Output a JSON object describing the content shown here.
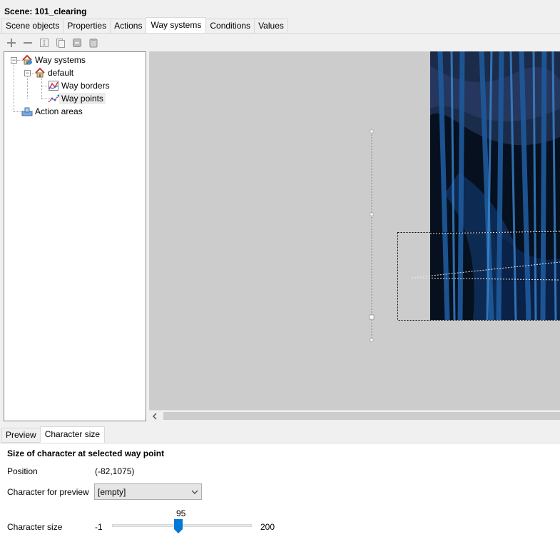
{
  "title": "Scene: 101_clearing",
  "tabs": [
    {
      "label": "Scene objects"
    },
    {
      "label": "Properties"
    },
    {
      "label": "Actions"
    },
    {
      "label": "Way systems",
      "active": true
    },
    {
      "label": "Conditions"
    },
    {
      "label": "Values"
    }
  ],
  "toolbar": {
    "icons": [
      "add-icon",
      "remove-icon",
      "rename-icon",
      "copy-icon",
      "cut-icon",
      "paste-icon"
    ]
  },
  "tree": {
    "root": {
      "label": "Way systems",
      "icon": "house-icon"
    },
    "default": {
      "label": "default",
      "icon": "house-icon"
    },
    "way_borders": {
      "label": "Way borders",
      "icon": "border-graph-icon"
    },
    "way_points": {
      "label": "Way points",
      "icon": "points-graph-icon",
      "selected": true
    },
    "action_areas": {
      "label": "Action areas",
      "icon": "area-icon"
    }
  },
  "bottom_tabs": [
    {
      "label": "Preview"
    },
    {
      "label": "Character size",
      "active": true
    }
  ],
  "character_size": {
    "heading": "Size of character at selected way point",
    "position_label": "Position",
    "position_value": "(-82,1075)",
    "preview_label": "Character for preview",
    "preview_selected": "[empty]",
    "size_label": "Character size",
    "slider_min": "-1",
    "slider_max": "200",
    "slider_value": "95"
  },
  "colors": {
    "accent": "#0078d7",
    "canvas_bg": "#cccccc",
    "image_bg": "#06101e"
  }
}
